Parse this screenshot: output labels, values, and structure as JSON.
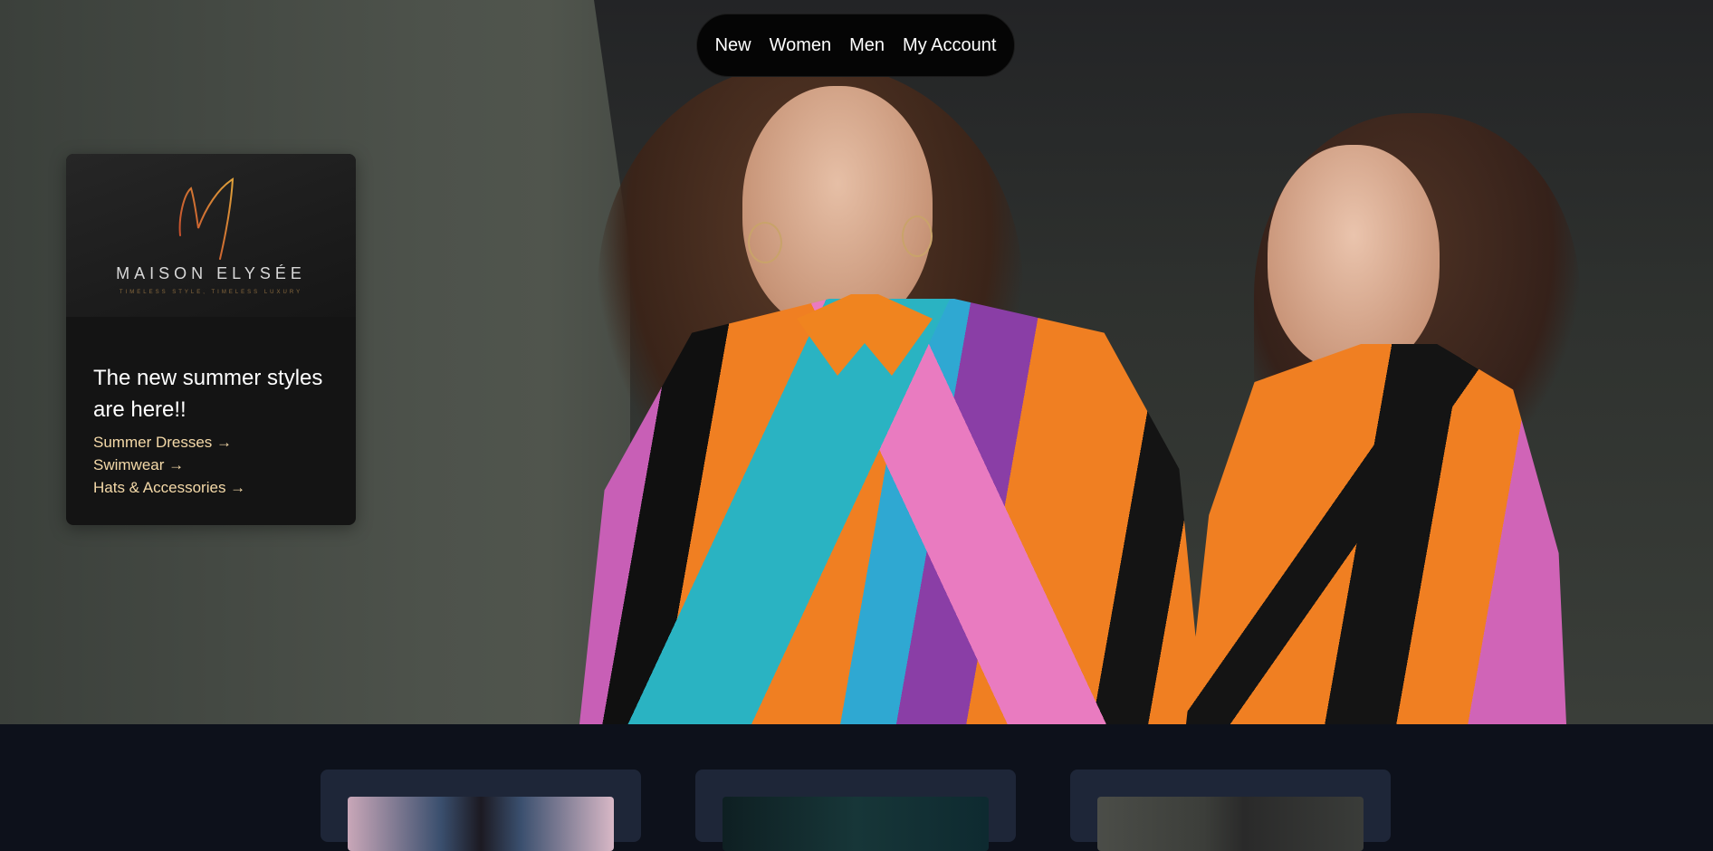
{
  "nav": {
    "items": [
      "New",
      "Women",
      "Men",
      "My Account"
    ]
  },
  "brand": {
    "name": "MAISON ELYSÉE",
    "tagline": "TIMELESS STYLE, TIMELESS LUXURY"
  },
  "promo": {
    "headline": "The new summer styles are here!!",
    "links": [
      "Summer Dresses →",
      "Swimwear →",
      "Hats & Accessories →"
    ]
  },
  "colors": {
    "accent": "#f4d9a8",
    "nav_bg": "#050505",
    "card_bg": "#141414",
    "strip_bg": "#0d111b",
    "product_card_bg": "#1e2638"
  }
}
